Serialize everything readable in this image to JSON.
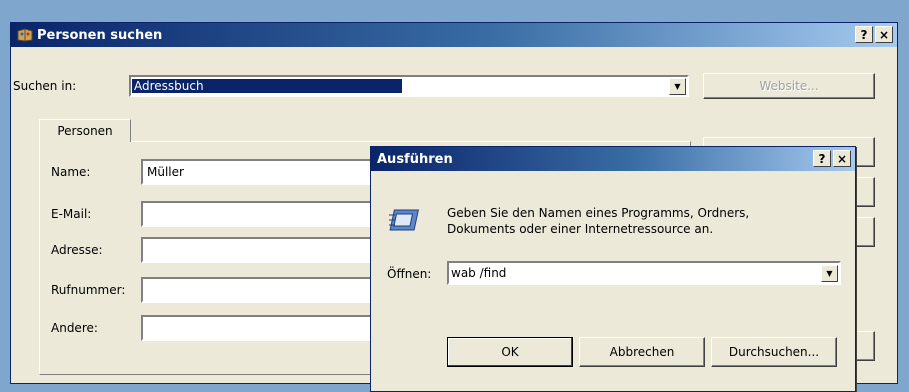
{
  "main_window": {
    "title": "Personen suchen",
    "help_btn": "?",
    "close_btn": "×",
    "search_in_label": "Suchen in:",
    "search_in_value": "Adressbuch",
    "website_btn": "Website...",
    "tab_label": "Personen",
    "fields": [
      {
        "label": "Name:",
        "value": "Müller"
      },
      {
        "label": "E-Mail:",
        "value": ""
      },
      {
        "label": "Adresse:",
        "value": ""
      },
      {
        "label": "Rufnummer:",
        "value": ""
      },
      {
        "label": "Andere:",
        "value": ""
      }
    ]
  },
  "run_dialog": {
    "title": "Ausführen",
    "help_btn": "?",
    "close_btn": "×",
    "description": "Geben Sie den Namen eines Programms, Ordners, Dokuments oder einer Internetressource an.",
    "description_line1": "Geben Sie den Namen eines Programms, Ordners,",
    "description_line2": "Dokuments oder einer Internetressource an.",
    "open_label": "Öffnen:",
    "open_value": "wab /find",
    "ok_btn": "OK",
    "cancel_btn": "Abbrechen",
    "browse_btn": "Durchsuchen..."
  },
  "colors": {
    "titlebar_start": "#0a246a",
    "titlebar_end": "#a6caf0",
    "window_bg": "#ece9d8",
    "selection": "#0a246a"
  }
}
